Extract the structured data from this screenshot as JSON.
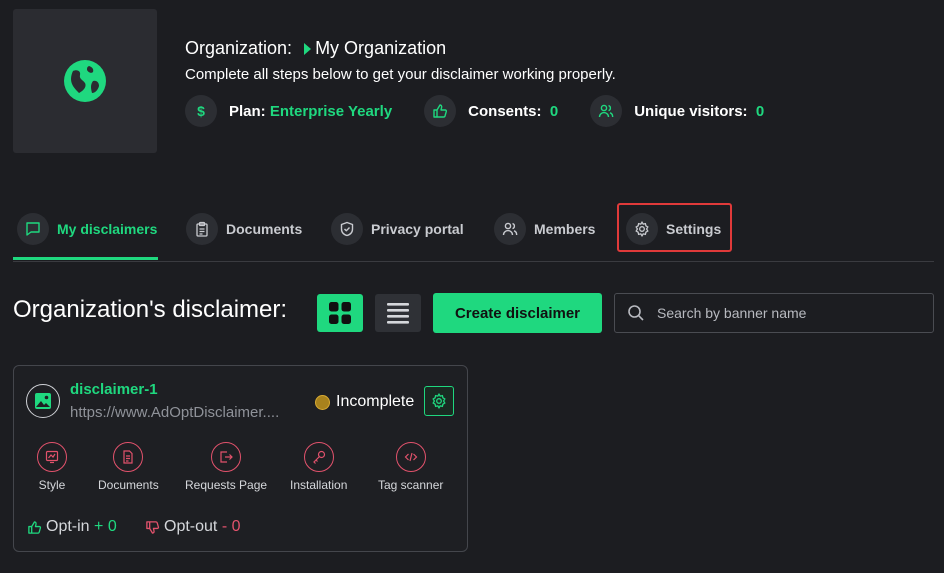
{
  "org": {
    "label": "Organization:",
    "name": "My Organization",
    "subtitle": "Complete all steps below to get your disclaimer working properly."
  },
  "stats": {
    "plan_label": "Plan:",
    "plan_value": "Enterprise Yearly",
    "consents_label": "Consents:",
    "consents_value": "0",
    "visitors_label": "Unique visitors:",
    "visitors_value": "0"
  },
  "tabs": [
    {
      "label": "My disclaimers",
      "icon": "message-square-icon",
      "active": true
    },
    {
      "label": "Documents",
      "icon": "clipboard-icon"
    },
    {
      "label": "Privacy portal",
      "icon": "shield-icon"
    },
    {
      "label": "Members",
      "icon": "users-icon"
    },
    {
      "label": "Settings",
      "icon": "gear-icon",
      "highlighted": true
    }
  ],
  "main": {
    "title": "Organization's disclaimer:",
    "create_label": "Create disclaimer",
    "search_placeholder": "Search by banner name"
  },
  "card": {
    "name": "disclaimer-1",
    "url": "https://www.AdOptDisclaimer....",
    "status": "Incomplete",
    "actions": [
      "Style",
      "Documents",
      "Requests Page",
      "Installation",
      "Tag scanner"
    ],
    "optin_label": "Opt-in",
    "optin_value": "+ 0",
    "optout_label": "Opt-out",
    "optout_value": "- 0"
  },
  "colors": {
    "accent": "#1fd87f",
    "background": "#1c1d21",
    "negative": "#e2526c",
    "status_incomplete": "#a8821d",
    "highlight": "#e03a3a"
  }
}
